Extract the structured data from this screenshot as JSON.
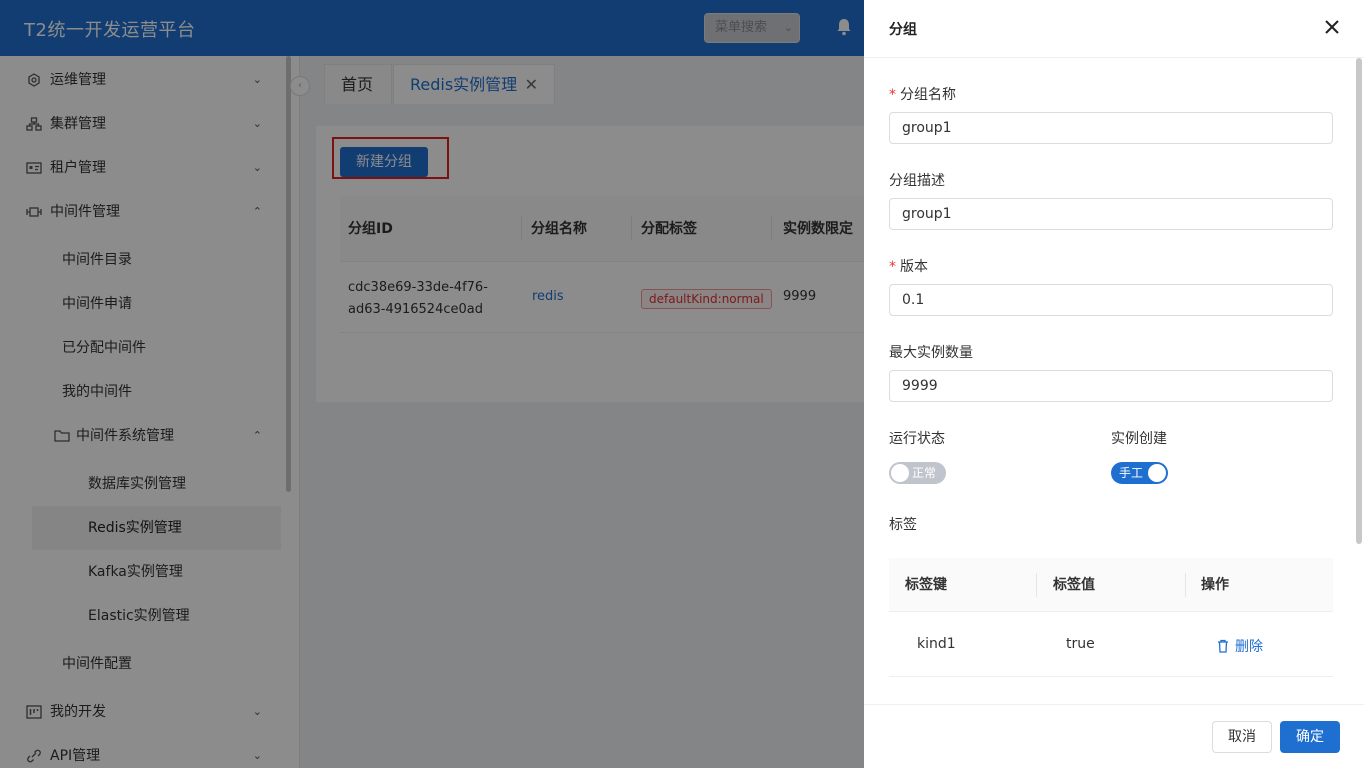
{
  "header": {
    "brand": "T2统一开发运营平台",
    "menu_search": "菜单搜索"
  },
  "sidebar": {
    "items": [
      {
        "label": "运维管理"
      },
      {
        "label": "集群管理"
      },
      {
        "label": "租户管理"
      },
      {
        "label": "中间件管理"
      },
      {
        "label": "中间件目录"
      },
      {
        "label": "中间件申请"
      },
      {
        "label": "已分配中间件"
      },
      {
        "label": "我的中间件"
      },
      {
        "label": "中间件系统管理"
      },
      {
        "label": "数据库实例管理"
      },
      {
        "label": "Redis实例管理"
      },
      {
        "label": "Kafka实例管理"
      },
      {
        "label": "Elastic实例管理"
      },
      {
        "label": "中间件配置"
      },
      {
        "label": "我的开发"
      },
      {
        "label": "API管理"
      }
    ]
  },
  "tabs": {
    "home": "首页",
    "redis": "Redis实例管理",
    "close": "✕"
  },
  "content": {
    "new_group": "新建分组",
    "columns": [
      "分组ID",
      "分组名称",
      "分配标签",
      "实例数限定"
    ],
    "row": {
      "id": "cdc38e69-33de-4f76-ad63-4916524ce0ad",
      "name": "redis",
      "tag": "defaultKind:normal",
      "limit": "9999"
    }
  },
  "drawer": {
    "title": "分组",
    "name_label": "分组名称",
    "name_value": "group1",
    "desc_label": "分组描述",
    "desc_value": "group1",
    "version_label": "版本",
    "version_value": "0.1",
    "max_label": "最大实例数量",
    "max_value": "9999",
    "run_status_label": "运行状态",
    "run_status_text": "正常",
    "instance_create_label": "实例创建",
    "instance_create_text": "手工",
    "tags_label": "标签",
    "tag_columns": [
      "标签键",
      "标签值",
      "操作"
    ],
    "tag_row": {
      "key": "kind1",
      "value": "true",
      "action": "删除"
    },
    "cancel": "取消",
    "ok": "确定"
  },
  "colors": {
    "primary": "#1f6fd1",
    "danger": "#e02020"
  }
}
